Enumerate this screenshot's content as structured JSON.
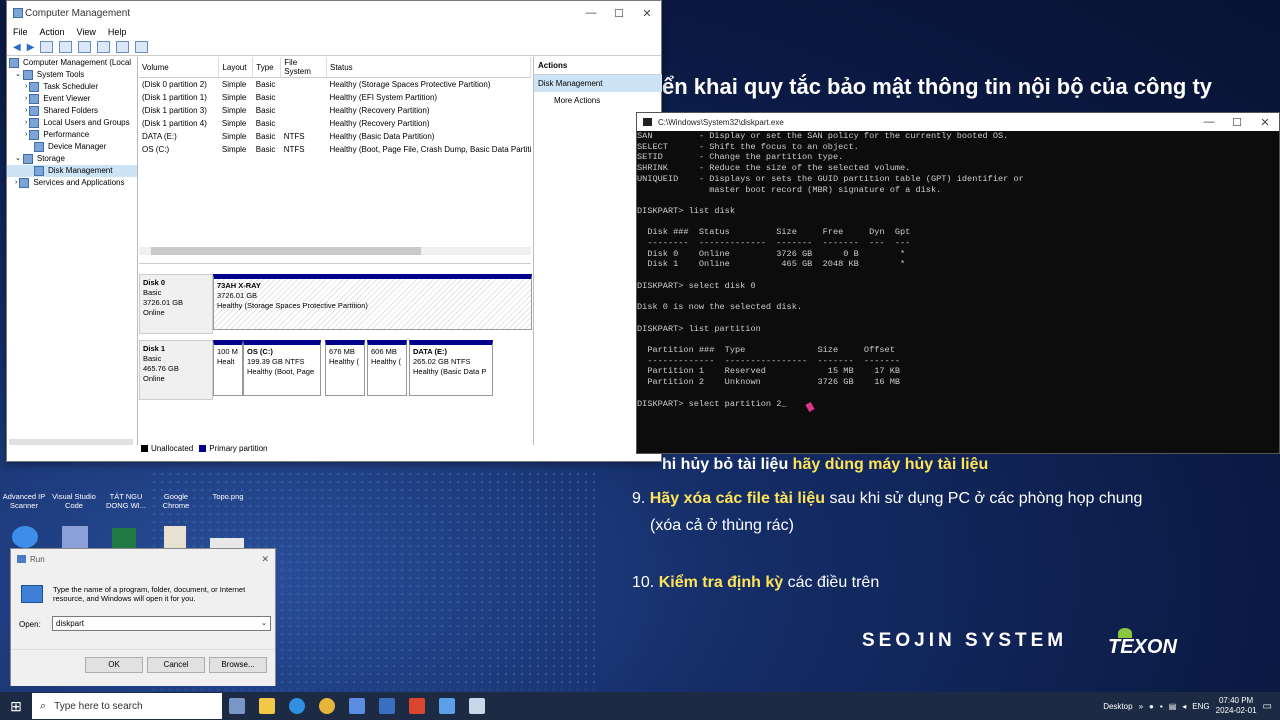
{
  "colors": {
    "accent": "#ffe45a",
    "primary_partition": "#00008b"
  },
  "slide": {
    "heading": "ển khai quy tắc bảo mật thông tin nội bộ của công ty",
    "line8_pre": "hi hủy bỏ tài liệu ",
    "line8_hl": "hãy dùng máy hủy tài liệu",
    "line9_num": "9. ",
    "line9_hl": "Hãy xóa các file tài liệu",
    "line9_post": " sau khi sử dụng PC ở các phòng họp chung",
    "line9_b": "(xóa cả ở thùng rác)",
    "line10_num": "10. ",
    "line10_hl": "Kiểm tra định kỳ",
    "line10_post": " các điều trên",
    "logo1": "SEOJIN SYSTEM",
    "logo2": "TEXON"
  },
  "cm": {
    "title": "Computer Management",
    "menu": [
      "File",
      "Action",
      "View",
      "Help"
    ],
    "tree": [
      "Computer Management (Local",
      "System Tools",
      "Task Scheduler",
      "Event Viewer",
      "Shared Folders",
      "Local Users and Groups",
      "Performance",
      "Device Manager",
      "Storage",
      "Disk Management",
      "Services and Applications"
    ],
    "cols": [
      "Volume",
      "Layout",
      "Type",
      "File System",
      "Status"
    ],
    "rows": [
      [
        "(Disk 0 partition 2)",
        "Simple",
        "Basic",
        "",
        "Healthy (Storage Spaces Protective Partition)"
      ],
      [
        "(Disk 1 partition 1)",
        "Simple",
        "Basic",
        "",
        "Healthy (EFI System Partition)"
      ],
      [
        "(Disk 1 partition 3)",
        "Simple",
        "Basic",
        "",
        "Healthy (Recovery Partition)"
      ],
      [
        "(Disk 1 partition 4)",
        "Simple",
        "Basic",
        "",
        "Healthy (Recovery Partition)"
      ],
      [
        "DATA (E:)",
        "Simple",
        "Basic",
        "NTFS",
        "Healthy (Basic Data Partition)"
      ],
      [
        "OS (C:)",
        "Simple",
        "Basic",
        "NTFS",
        "Healthy (Boot, Page File, Crash Dump, Basic Data Partitio"
      ]
    ],
    "disk0": {
      "name": "Disk 0",
      "type": "Basic",
      "size": "3726.01 GB",
      "state": "Online",
      "p_name": "73AH X-RAY",
      "p_size": "3726.01 GB",
      "p_status": "Healthy (Storage Spaces Protective Partition)"
    },
    "disk1": {
      "name": "Disk 1",
      "type": "Basic",
      "size": "465.76 GB",
      "state": "Online",
      "parts": [
        {
          "name": "",
          "size": "100 M",
          "status": "Healt"
        },
        {
          "name": "OS  (C:)",
          "size": "199.39 GB NTFS",
          "status": "Healthy (Boot, Page"
        },
        {
          "name": "",
          "size": "676 MB",
          "status": "Healthy ("
        },
        {
          "name": "",
          "size": "606 MB",
          "status": "Healthy ("
        },
        {
          "name": "DATA  (E:)",
          "size": "265.02 GB NTFS",
          "status": "Healthy (Basic Data P"
        }
      ]
    },
    "legend_unalloc": "Unallocated",
    "legend_primary": "Primary partition",
    "actions_header": "Actions",
    "actions_item": "Disk Management",
    "actions_more": "More Actions"
  },
  "cmd": {
    "title": "C:\\Windows\\System32\\diskpart.exe",
    "text": "SAN         - Display or set the SAN policy for the currently booted OS.\nSELECT      - Shift the focus to an object.\nSETID       - Change the partition type.\nSHRINK      - Reduce the size of the selected volume.\nUNIQUEID    - Displays or sets the GUID partition table (GPT) identifier or\n              master boot record (MBR) signature of a disk.\n\nDISKPART> list disk\n\n  Disk ###  Status         Size     Free     Dyn  Gpt\n  --------  -------------  -------  -------  ---  ---\n  Disk 0    Online         3726 GB      0 B        *\n  Disk 1    Online          465 GB  2048 KB        *\n\nDISKPART> select disk 0\n\nDisk 0 is now the selected disk.\n\nDISKPART> list partition\n\n  Partition ###  Type              Size     Offset\n  -------------  ----------------  -------  -------\n  Partition 1    Reserved            15 MB    17 KB\n  Partition 2    Unknown           3726 GB    16 MB\n\nDISKPART> select partition 2_"
  },
  "desktop": [
    {
      "label": "Advanced IP Scanner",
      "color": "#2e7fd1"
    },
    {
      "label": "Visual Studio Code",
      "color": "#2b8be0"
    },
    {
      "label": "TÁT NGU DONG WI...",
      "color": "#d8d8d8"
    },
    {
      "label": "Google Chrome",
      "color": "#e6b63a"
    },
    {
      "label": "Topo.png",
      "color": "#c9c9c9"
    }
  ],
  "run": {
    "title": "Run",
    "desc": "Type the name of a program, folder, document, or Internet resource, and Windows will open it for you.",
    "open_label": "Open:",
    "value": "diskpart",
    "ok": "OK",
    "cancel": "Cancel",
    "browse": "Browse..."
  },
  "taskbar": {
    "search": "Type here to search",
    "desktop": "Desktop",
    "lang": "ENG",
    "time": "07:40 PM",
    "date": "2024-02-01"
  }
}
